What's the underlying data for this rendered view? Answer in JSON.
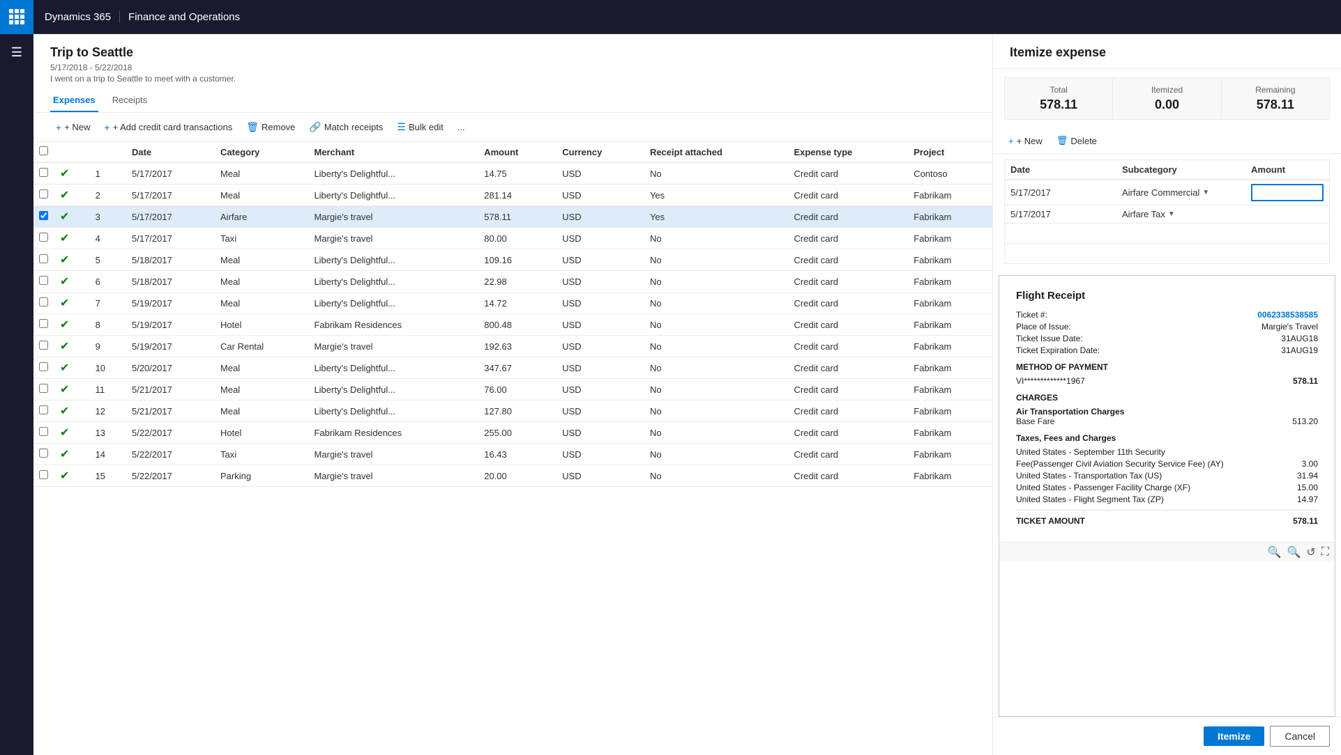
{
  "topnav": {
    "dynamics_label": "Dynamics 365",
    "module_label": "Finance and Operations"
  },
  "page": {
    "title": "Trip to Seattle",
    "date_range": "5/17/2018 - 5/22/2018",
    "description": "I went on a trip to Seattle to meet with a customer."
  },
  "tabs": [
    {
      "id": "expenses",
      "label": "Expenses",
      "active": true
    },
    {
      "id": "receipts",
      "label": "Receipts",
      "active": false
    }
  ],
  "toolbar": {
    "new_label": "+ New",
    "add_cc_label": "+ Add credit card transactions",
    "remove_label": "Remove",
    "match_receipts_label": "Match receipts",
    "bulk_edit_label": "Bulk edit",
    "more_label": "..."
  },
  "table": {
    "columns": [
      "",
      "",
      "Date",
      "Category",
      "Merchant",
      "Amount",
      "Currency",
      "Receipt attached",
      "Expense type",
      "Project"
    ],
    "rows": [
      {
        "num": 1,
        "date": "5/17/2017",
        "category": "Meal",
        "merchant": "Liberty's Delightful...",
        "amount": "14.75",
        "currency": "USD",
        "receipt": "No",
        "expense_type": "Credit card",
        "project": "Contoso",
        "selected": false
      },
      {
        "num": 2,
        "date": "5/17/2017",
        "category": "Meal",
        "merchant": "Liberty's Delightful...",
        "amount": "281.14",
        "currency": "USD",
        "receipt": "Yes",
        "expense_type": "Credit card",
        "project": "Fabrikam",
        "selected": false
      },
      {
        "num": 3,
        "date": "5/17/2017",
        "category": "Airfare",
        "merchant": "Margie's travel",
        "amount": "578.11",
        "currency": "USD",
        "receipt": "Yes",
        "expense_type": "Credit card",
        "project": "Fabrikam",
        "selected": true
      },
      {
        "num": 4,
        "date": "5/17/2017",
        "category": "Taxi",
        "merchant": "Margie's travel",
        "amount": "80.00",
        "currency": "USD",
        "receipt": "No",
        "expense_type": "Credit card",
        "project": "Fabrikam",
        "selected": false
      },
      {
        "num": 5,
        "date": "5/18/2017",
        "category": "Meal",
        "merchant": "Liberty's Delightful...",
        "amount": "109.16",
        "currency": "USD",
        "receipt": "No",
        "expense_type": "Credit card",
        "project": "Fabrikam",
        "selected": false
      },
      {
        "num": 6,
        "date": "5/18/2017",
        "category": "Meal",
        "merchant": "Liberty's Delightful...",
        "amount": "22.98",
        "currency": "USD",
        "receipt": "No",
        "expense_type": "Credit card",
        "project": "Fabrikam",
        "selected": false
      },
      {
        "num": 7,
        "date": "5/19/2017",
        "category": "Meal",
        "merchant": "Liberty's Delightful...",
        "amount": "14.72",
        "currency": "USD",
        "receipt": "No",
        "expense_type": "Credit card",
        "project": "Fabrikam",
        "selected": false
      },
      {
        "num": 8,
        "date": "5/19/2017",
        "category": "Hotel",
        "merchant": "Fabrikam Residences",
        "amount": "800.48",
        "currency": "USD",
        "receipt": "No",
        "expense_type": "Credit card",
        "project": "Fabrikam",
        "selected": false
      },
      {
        "num": 9,
        "date": "5/19/2017",
        "category": "Car Rental",
        "merchant": "Margie's travel",
        "amount": "192.63",
        "currency": "USD",
        "receipt": "No",
        "expense_type": "Credit card",
        "project": "Fabrikam",
        "selected": false
      },
      {
        "num": 10,
        "date": "5/20/2017",
        "category": "Meal",
        "merchant": "Liberty's Delightful...",
        "amount": "347.67",
        "currency": "USD",
        "receipt": "No",
        "expense_type": "Credit card",
        "project": "Fabrikam",
        "selected": false
      },
      {
        "num": 11,
        "date": "5/21/2017",
        "category": "Meal",
        "merchant": "Liberty's Delightful...",
        "amount": "76.00",
        "currency": "USD",
        "receipt": "No",
        "expense_type": "Credit card",
        "project": "Fabrikam",
        "selected": false
      },
      {
        "num": 12,
        "date": "5/21/2017",
        "category": "Meal",
        "merchant": "Liberty's Delightful...",
        "amount": "127.80",
        "currency": "USD",
        "receipt": "No",
        "expense_type": "Credit card",
        "project": "Fabrikam",
        "selected": false
      },
      {
        "num": 13,
        "date": "5/22/2017",
        "category": "Hotel",
        "merchant": "Fabrikam Residences",
        "amount": "255.00",
        "currency": "USD",
        "receipt": "No",
        "expense_type": "Credit card",
        "project": "Fabrikam",
        "selected": false
      },
      {
        "num": 14,
        "date": "5/22/2017",
        "category": "Taxi",
        "merchant": "Margie's travel",
        "amount": "16.43",
        "currency": "USD",
        "receipt": "No",
        "expense_type": "Credit card",
        "project": "Fabrikam",
        "selected": false
      },
      {
        "num": 15,
        "date": "5/22/2017",
        "category": "Parking",
        "merchant": "Margie's travel",
        "amount": "20.00",
        "currency": "USD",
        "receipt": "No",
        "expense_type": "Credit card",
        "project": "Fabrikam",
        "selected": false
      }
    ]
  },
  "right_panel": {
    "title": "Itemize expense",
    "summary": {
      "total_label": "Total",
      "total_value": "578.11",
      "itemized_label": "Itemized",
      "itemized_value": "0.00",
      "remaining_label": "Remaining",
      "remaining_value": "578.11"
    },
    "toolbar": {
      "new_label": "+ New",
      "delete_label": "Delete"
    },
    "grid": {
      "col_date": "Date",
      "col_subcategory": "Subcategory",
      "col_amount": "Amount",
      "rows": [
        {
          "date": "5/17/2017",
          "subcategory": "Airfare Commercial",
          "amount": ""
        },
        {
          "date": "5/17/2017",
          "subcategory": "Airfare Tax",
          "amount": ""
        },
        {
          "empty1": true
        },
        {
          "empty2": true
        }
      ]
    },
    "receipt": {
      "title": "Flight Receipt",
      "ticket_num_label": "Ticket #:",
      "ticket_num_value": "0062338538585",
      "place_of_issue_label": "Place of Issue:",
      "place_of_issue_value": "Margie's Travel",
      "ticket_issue_date_label": "Ticket Issue Date:",
      "ticket_issue_date_value": "31AUG18",
      "ticket_expiration_label": "Ticket Expiration Date:",
      "ticket_expiration_value": "31AUG19",
      "method_label": "METHOD OF PAYMENT",
      "card_num": "VI*************1967",
      "card_amount": "578.11",
      "charges_label": "CHARGES",
      "air_transport_label": "Air Transportation Charges",
      "base_fare_label": "Base Fare",
      "base_fare_value": "513.20",
      "taxes_label": "Taxes, Fees and Charges",
      "tax_rows": [
        {
          "label": "United States - September 11th Security",
          "value": ""
        },
        {
          "label": "Fee(Passenger Civil Aviation Security Service Fee) (AY)",
          "value": "3.00"
        },
        {
          "label": "United States - Transportation Tax (US)",
          "value": "31.94"
        },
        {
          "label": "United States - Passenger Facility Charge (XF)",
          "value": "15.00"
        },
        {
          "label": "United States - Flight Segment Tax (ZP)",
          "value": "14.97"
        }
      ],
      "ticket_amount_label": "TICKET AMOUNT",
      "ticket_amount_value": "578.11"
    },
    "buttons": {
      "itemize_label": "Itemize",
      "cancel_label": "Cancel"
    }
  }
}
